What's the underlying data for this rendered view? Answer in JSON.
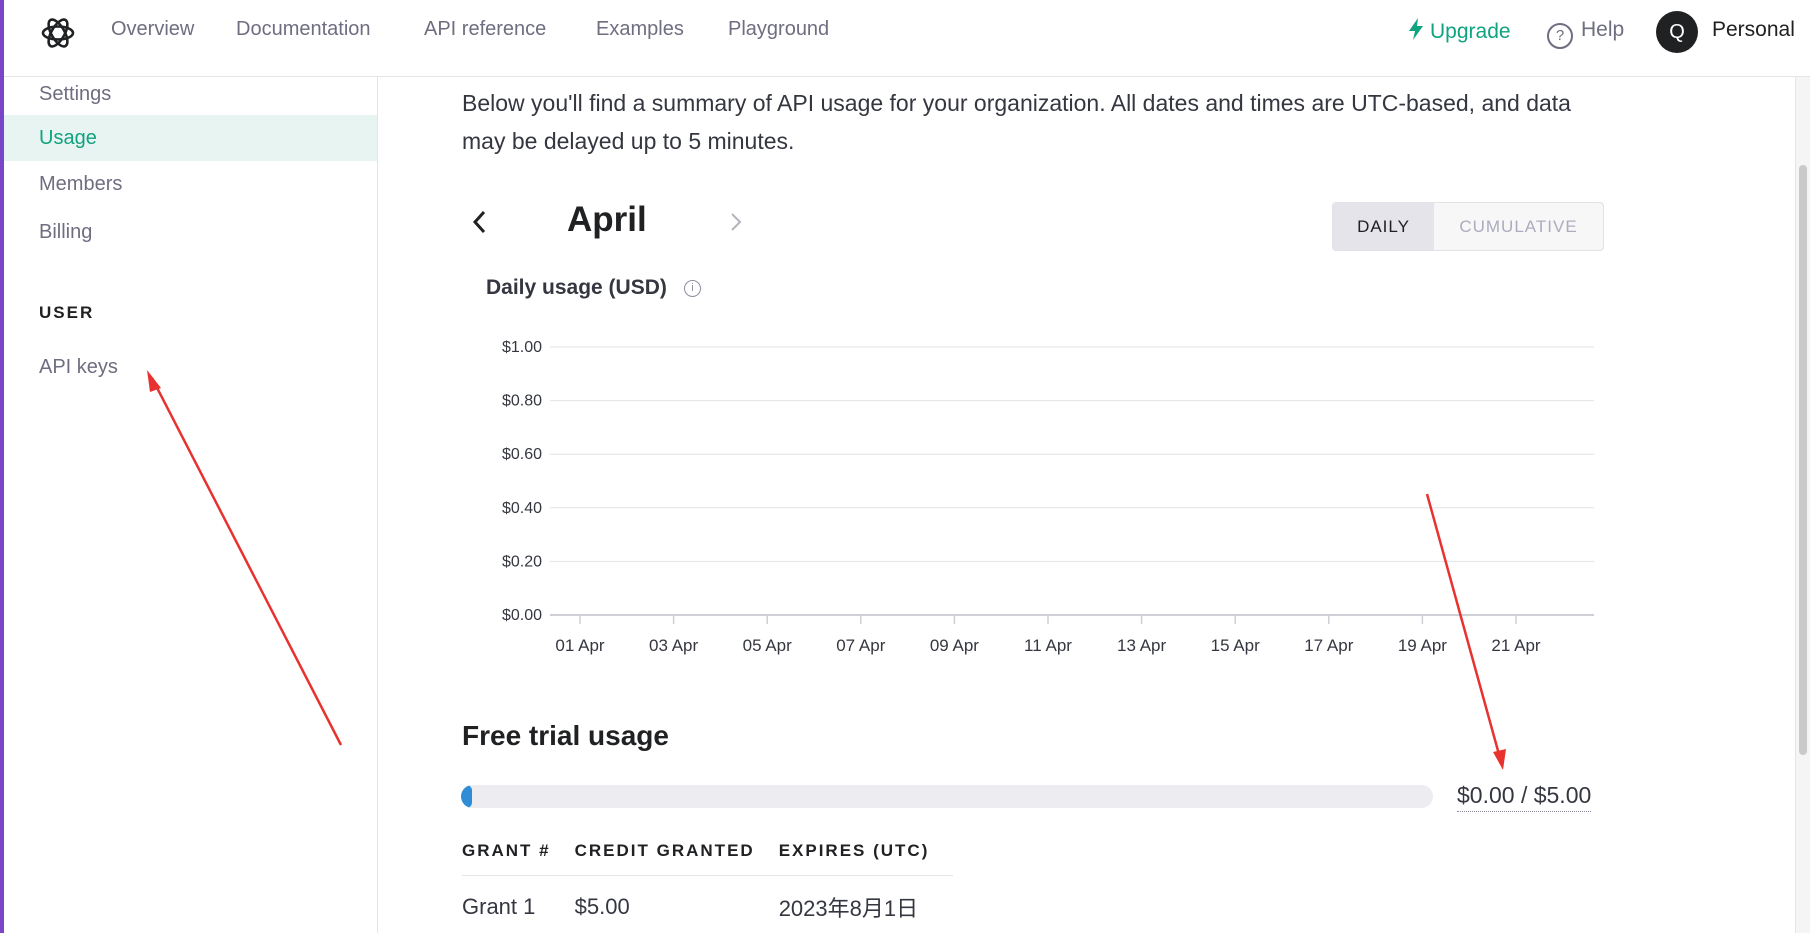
{
  "nav": {
    "links": [
      "Overview",
      "Documentation",
      "API reference",
      "Examples",
      "Playground"
    ],
    "upgrade": "Upgrade",
    "help": "Help",
    "help_icon_glyph": "?",
    "avatar_initial": "Q",
    "account": "Personal"
  },
  "sidebar": {
    "items": [
      {
        "label": "Settings",
        "active": false
      },
      {
        "label": "Usage",
        "active": true
      },
      {
        "label": "Members",
        "active": false
      },
      {
        "label": "Billing",
        "active": false
      }
    ],
    "user_heading": "USER",
    "user_items": [
      {
        "label": "API keys"
      }
    ]
  },
  "main": {
    "intro": "Below you'll find a summary of API usage for your organization. All dates and times are UTC-based, and data may be delayed up to 5 minutes.",
    "month": "April",
    "toggle": {
      "daily": "DAILY",
      "cumulative": "CUMULATIVE"
    },
    "chart_title": "Daily usage (USD)",
    "info_glyph": "i"
  },
  "chart_data": {
    "type": "bar",
    "title": "Daily usage (USD)",
    "x_ticks": [
      "01 Apr",
      "03 Apr",
      "05 Apr",
      "07 Apr",
      "09 Apr",
      "11 Apr",
      "13 Apr",
      "15 Apr",
      "17 Apr",
      "19 Apr",
      "21 Apr"
    ],
    "y_ticks": [
      "$0.00",
      "$0.20",
      "$0.40",
      "$0.60",
      "$0.80",
      "$1.00"
    ],
    "ylim": [
      0,
      1
    ],
    "values": [],
    "grid": true
  },
  "trial": {
    "title": "Free trial usage",
    "used": 0,
    "limit": 5,
    "text": "$0.00 / $5.00",
    "table": {
      "headers": [
        "GRANT #",
        "CREDIT GRANTED",
        "EXPIRES (UTC)"
      ],
      "rows": [
        [
          "Grant 1",
          "$5.00",
          "2023年8月1日"
        ]
      ]
    }
  },
  "colors": {
    "accent": "#10a37f",
    "progress": "#2e8dd6",
    "annotation_arrow": "#e8322f"
  }
}
